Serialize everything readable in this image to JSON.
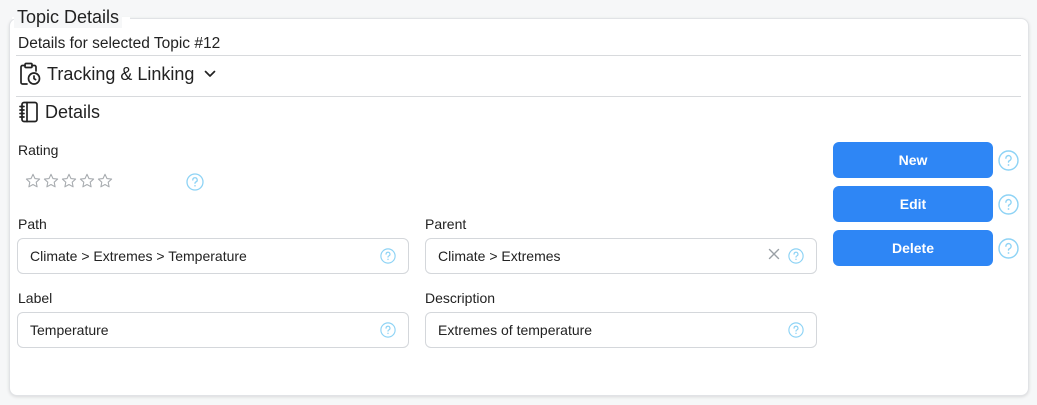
{
  "panel": {
    "legend": "Topic Details",
    "subtitle": "Details for selected Topic #12"
  },
  "sections": {
    "tracking": {
      "label": "Tracking & Linking",
      "icon": "clipboard-clock-icon",
      "expander": "chevron-down-icon"
    },
    "details": {
      "label": "Details",
      "icon": "notebook-icon"
    }
  },
  "fields": {
    "rating": {
      "label": "Rating",
      "stars_total": 5,
      "stars_filled": 0
    },
    "path": {
      "label": "Path",
      "value": "Climate > Extremes > Temperature"
    },
    "parent": {
      "label": "Parent",
      "value": "Climate > Extremes"
    },
    "label": {
      "label": "Label",
      "value": "Temperature"
    },
    "description": {
      "label": "Description",
      "value": "Extremes of temperature"
    }
  },
  "buttons": {
    "new": "New",
    "edit": "Edit",
    "delete": "Delete"
  },
  "colors": {
    "primary": "#2e86f5",
    "help_icon": "#8ed3f5",
    "star_outline": "#a8acb0"
  }
}
